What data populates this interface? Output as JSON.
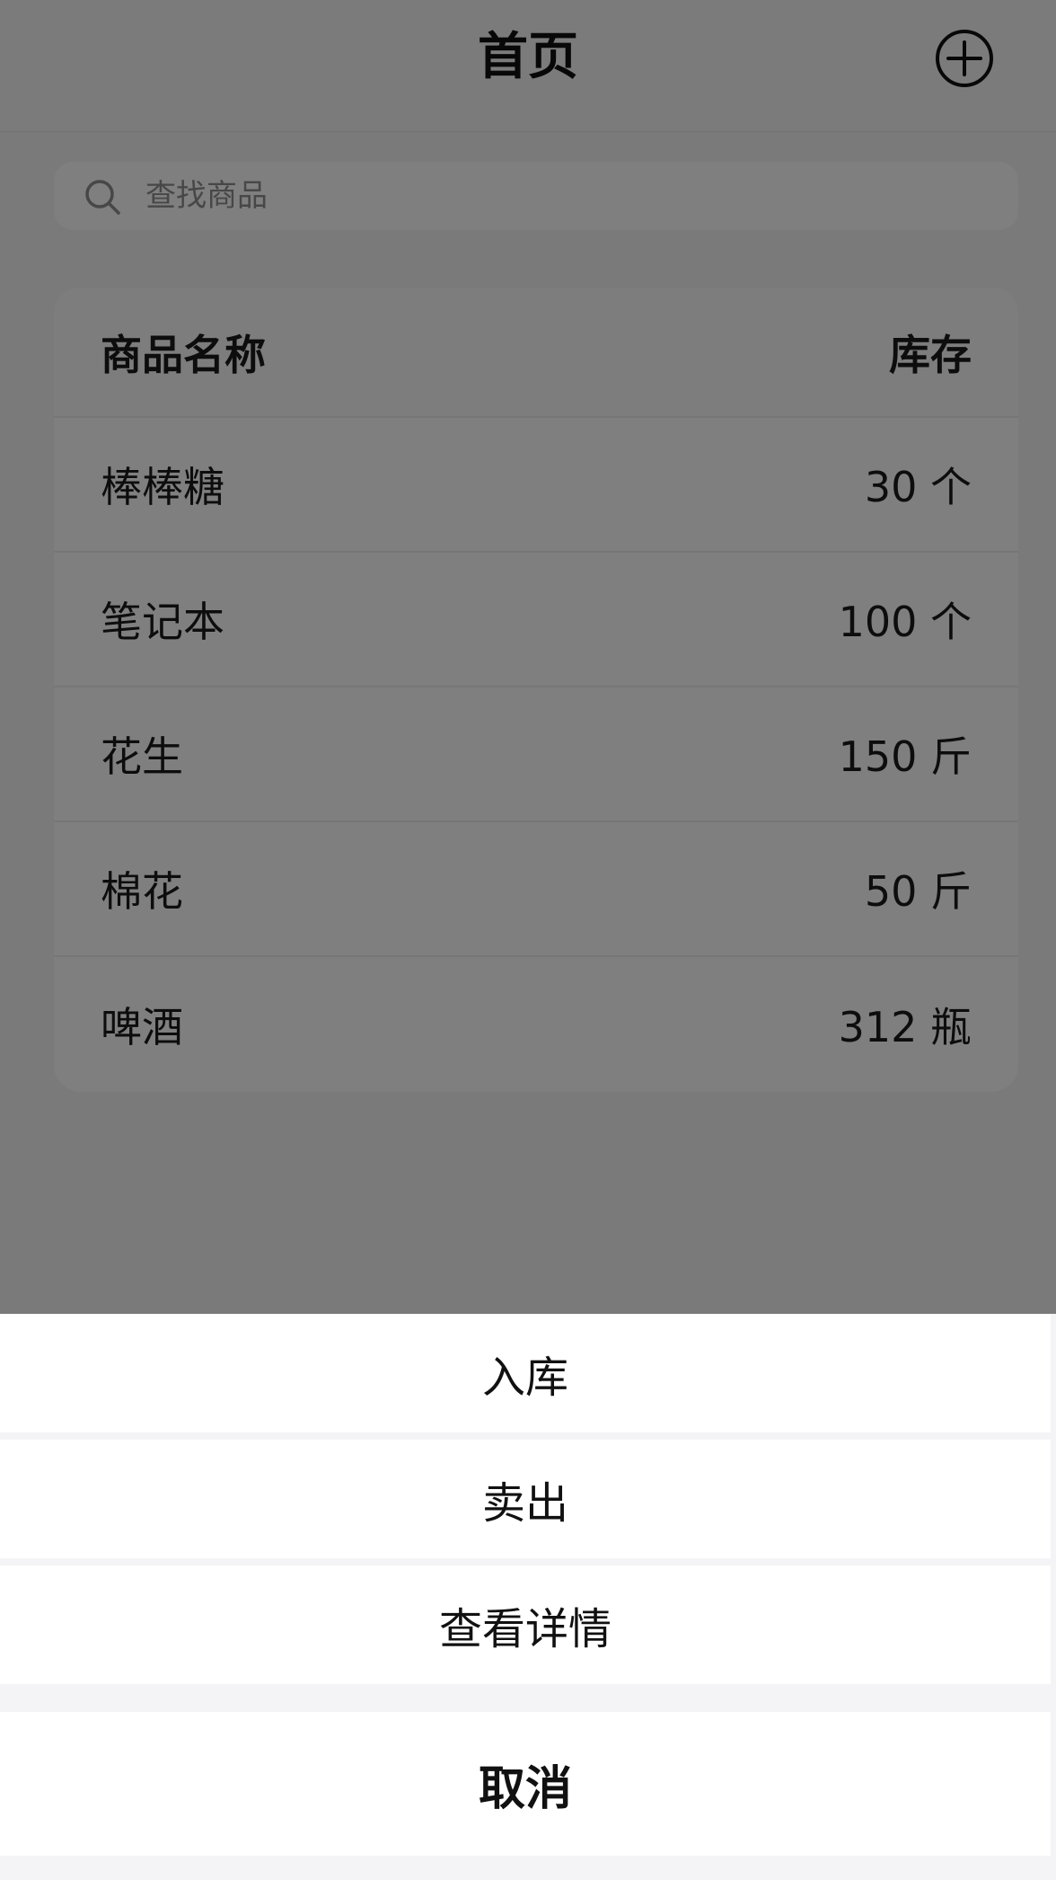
{
  "navbar": {
    "title": "首页",
    "add_icon": "plus-circle-icon"
  },
  "search": {
    "placeholder": "查找商品",
    "value": "",
    "icon": "search-icon"
  },
  "table": {
    "headers": {
      "name": "商品名称",
      "stock": "库存"
    },
    "rows": [
      {
        "name": "棒棒糖",
        "stock": "30 个"
      },
      {
        "name": "笔记本",
        "stock": "100 个"
      },
      {
        "name": "花生",
        "stock": "150 斤"
      },
      {
        "name": "棉花",
        "stock": "50 斤"
      },
      {
        "name": "啤酒",
        "stock": "312 瓶"
      }
    ]
  },
  "action_sheet": {
    "items": [
      {
        "label": "入库"
      },
      {
        "label": "卖出"
      },
      {
        "label": "查看详情"
      }
    ],
    "cancel_label": "取消"
  },
  "colors": {
    "background": "#f4f4f6",
    "card": "#ffffff",
    "overlay": "rgba(0,0,0,0.5)",
    "text": "#111111"
  }
}
